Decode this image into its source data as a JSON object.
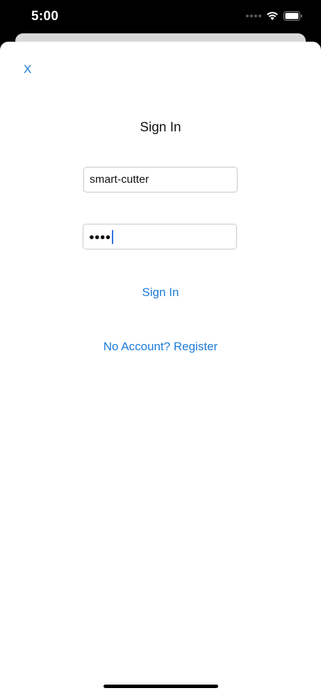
{
  "status_bar": {
    "time": "5:00",
    "icons": [
      "cellular-signal-icon",
      "wifi-icon",
      "battery-icon"
    ]
  },
  "modal": {
    "close_label": "X",
    "title": "Sign In",
    "username": {
      "value": "smart-cutter"
    },
    "password": {
      "masked_value": "●●●●"
    },
    "sign_in_label": "Sign In",
    "register_label": "No Account? Register"
  },
  "colors": {
    "accent": "#1a7ad9",
    "caret": "#2f6fe0",
    "background": "#ffffff",
    "status_bar_bg": "#000000"
  }
}
